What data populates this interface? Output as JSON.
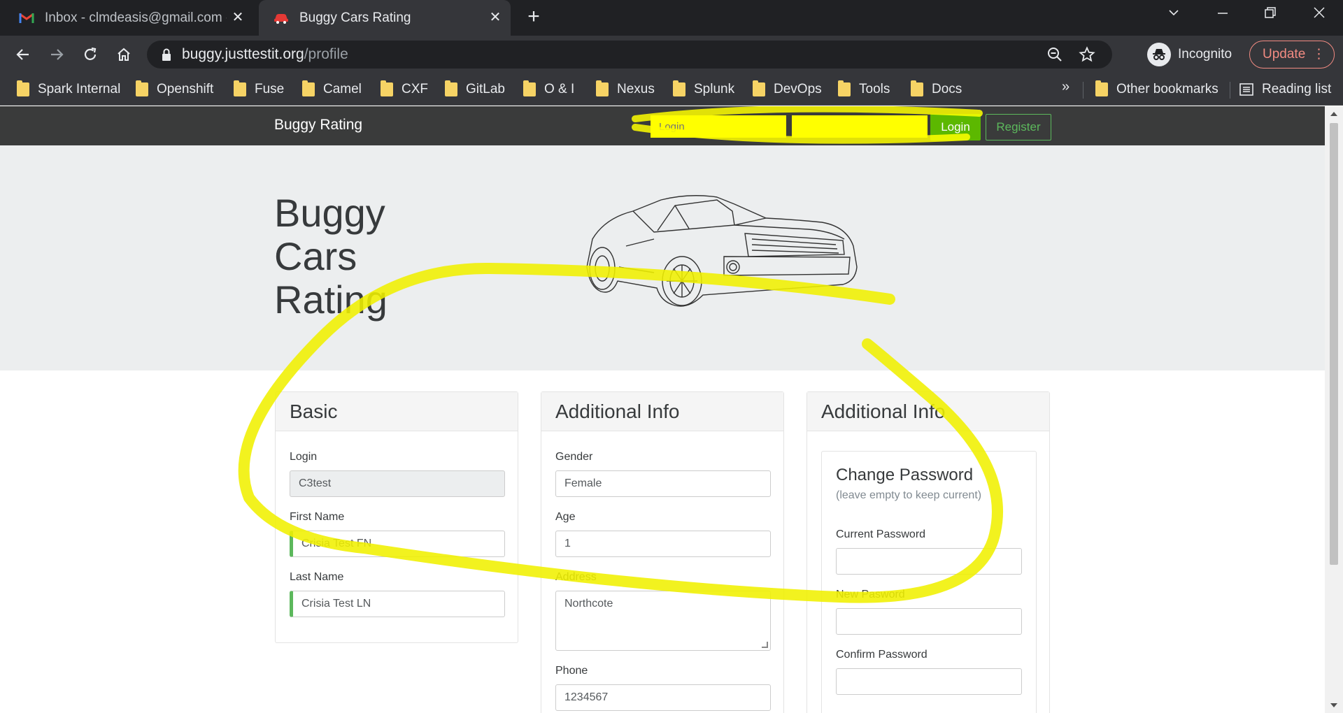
{
  "browser": {
    "tabs": [
      {
        "title": "Inbox - clmdeasis@gmail.com - Gmail",
        "active": false
      },
      {
        "title": "Buggy Cars Rating",
        "active": true
      }
    ],
    "url_host": "buggy.justtestit.org",
    "url_path": "/profile",
    "profile_label": "Incognito",
    "update_label": "Update",
    "bookmarks": [
      "Spark Internal",
      "Openshift",
      "Fuse",
      "Camel",
      "CXF",
      "GitLab",
      "O & I",
      "Nexus",
      "Splunk",
      "DevOps",
      "Tools",
      "Docs"
    ],
    "more_label": "»",
    "other_bookmarks": "Other bookmarks",
    "reading_list": "Reading list"
  },
  "navbar": {
    "brand": "Buggy Rating",
    "login_placeholder": "Login",
    "password_placeholder": "",
    "login_button": "Login",
    "register_button": "Register"
  },
  "hero": {
    "title_lines": [
      "Buggy",
      "Cars",
      "Rating"
    ]
  },
  "basic": {
    "heading": "Basic",
    "login_label": "Login",
    "login_value": "C3test",
    "first_name_label": "First Name",
    "first_name_value": "Crisia Test FN",
    "last_name_label": "Last Name",
    "last_name_value": "Crisia Test LN"
  },
  "additional": {
    "heading": "Additional Info",
    "gender_label": "Gender",
    "gender_value": "Female",
    "age_label": "Age",
    "age_value": "1",
    "address_label": "Address",
    "address_value": "Northcote",
    "phone_label": "Phone",
    "phone_value": "1234567"
  },
  "password": {
    "heading": "Additional Info",
    "title": "Change Password",
    "hint": "(leave empty to keep current)",
    "current_label": "Current Password",
    "new_label": "New Pasword",
    "confirm_label": "Confirm Password"
  },
  "colors": {
    "highlight": "#ffff00",
    "login_green": "#5cb800",
    "valid_green": "#5cb85c"
  }
}
